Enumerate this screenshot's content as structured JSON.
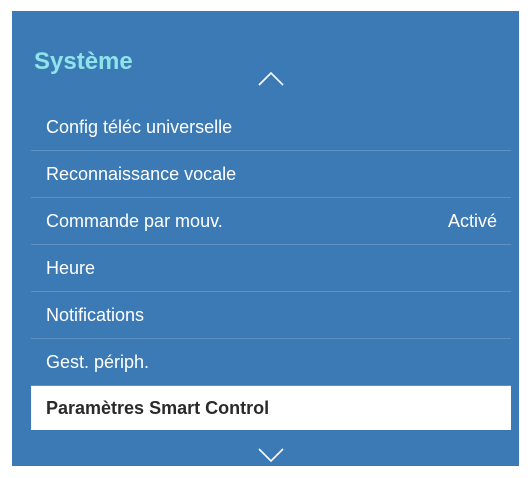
{
  "header": {
    "title": "Système",
    "title_color": "#8fe3ea"
  },
  "panel_color": "#3b7ab5",
  "scroll": {
    "up_icon": "chevron-up-icon",
    "down_icon": "chevron-down-icon"
  },
  "menu": {
    "items": [
      {
        "label": "Config téléc universelle",
        "value": ""
      },
      {
        "label": "Reconnaissance vocale",
        "value": ""
      },
      {
        "label": "Commande par mouv.",
        "value": "Activé"
      },
      {
        "label": "Heure",
        "value": ""
      },
      {
        "label": "Notifications",
        "value": ""
      },
      {
        "label": "Gest. périph.",
        "value": ""
      },
      {
        "label": "Paramètres Smart Control",
        "value": "",
        "selected": true
      }
    ]
  }
}
